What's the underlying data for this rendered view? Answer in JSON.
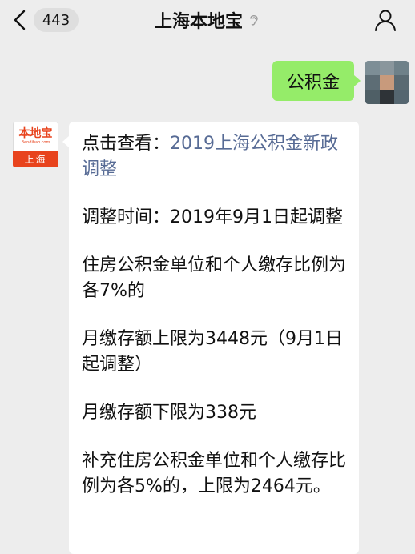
{
  "header": {
    "unread_count": "443",
    "title": "上海本地宝"
  },
  "sent_message": {
    "text": "公积金"
  },
  "brand_avatar": {
    "logo_text": "本地宝",
    "logo_url": "Bendibao.com",
    "city": "上海"
  },
  "reply": {
    "intro_prefix": "点击查看：",
    "intro_link": "2019上海公积金新政调整",
    "paragraphs": [
      "调整时间：2019年9月1日起调整",
      "住房公积金单位和个人缴存比例为各7%的",
      "月缴存额上限为3448元（9月1日起调整）",
      "月缴存额下限为338元",
      "补充住房公积金单位和个人缴存比例为各5%的，上限为2464元。"
    ]
  },
  "colors": {
    "background": "#ededed",
    "sent_bubble": "#95ec69",
    "received_bubble": "#ffffff",
    "link": "#576b95",
    "brand": "#e8431d"
  },
  "icons": {
    "back": "chevron-left-icon",
    "mute": "ear-icon",
    "profile": "person-icon"
  }
}
